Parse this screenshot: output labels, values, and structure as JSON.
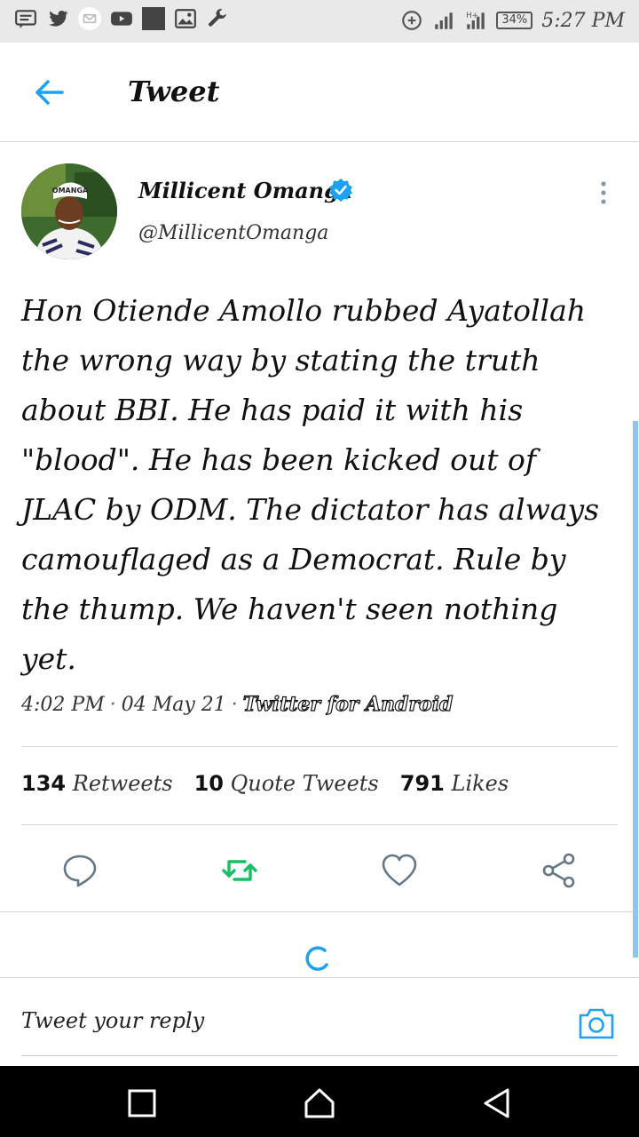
{
  "status_bar": {
    "battery": "34%",
    "time": "5:27 PM"
  },
  "header": {
    "title": "Tweet"
  },
  "author": {
    "name": "Millicent Omanga",
    "handle": "@MillicentOmanga",
    "avatar_cap_text": "OMANGA"
  },
  "tweet": {
    "text": "Hon Otiende Amollo rubbed Ayatollah the wrong way by stating the truth about BBI. He has paid it with his \"blood\". He has been kicked out of JLAC by ODM. The dictator has always camouflaged as a Democrat. Rule by the thump. We haven't seen nothing yet.",
    "time": "4:02 PM",
    "date": "04 May 21",
    "separator": "·",
    "source": "Twitter for Android"
  },
  "stats": {
    "retweets_count": "134",
    "retweets_label": "Retweets",
    "quotes_count": "10",
    "quotes_label": "Quote Tweets",
    "likes_count": "791",
    "likes_label": "Likes"
  },
  "reply": {
    "placeholder": "Tweet your reply"
  },
  "colors": {
    "accent": "#1da1f2",
    "retweet_green": "#17bf63",
    "icon_gray": "#657786"
  },
  "icons": {
    "back": "arrow-left-icon",
    "verified": "verified-badge-icon",
    "more": "more-vertical-icon",
    "reply": "reply-bubble-icon",
    "retweet": "retweet-icon",
    "like": "heart-icon",
    "share": "share-icon",
    "camera": "camera-icon"
  }
}
